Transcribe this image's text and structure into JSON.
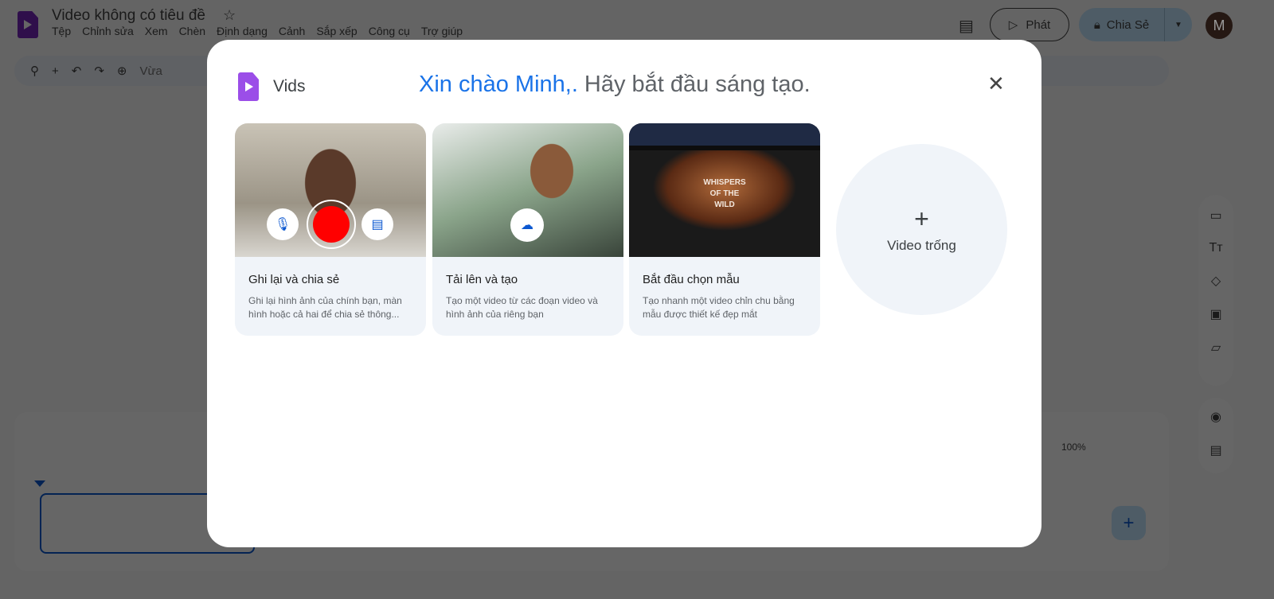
{
  "app": {
    "title": "Video không có tiêu đề",
    "menu": [
      "Tệp",
      "Chỉnh sửa",
      "Xem",
      "Chèn",
      "Định dạng",
      "Cảnh",
      "Sắp xếp",
      "Công cụ",
      "Trợ giúp"
    ],
    "toolbar_fit": "Vừa",
    "play_label": "Phát",
    "share_label": "Chia Sẻ",
    "avatar_initial": "M",
    "zoom_level": "100%"
  },
  "modal": {
    "brand": "Vids",
    "greeting": "Xin chào Minh,.",
    "greeting_rest": "Hãy bắt đầu sáng tạo.",
    "cards": [
      {
        "title": "Ghi lại và chia sẻ",
        "desc": "Ghi lại hình ảnh của chính bạn, màn hình hoặc cả hai để chia sẻ thông..."
      },
      {
        "title": "Tải lên và tạo",
        "desc": "Tạo một video từ các đoạn video và hình ảnh của riêng bạn"
      },
      {
        "title": "Bắt đầu chọn mẫu",
        "desc": "Tạo nhanh một video chỉn chu bằng mẫu được thiết kế đẹp mắt",
        "thumb_text": "WHISPERS OF THE WILD"
      }
    ],
    "blank_label": "Video trống"
  },
  "colors": {
    "accent": "#0b57d0",
    "record": "#ff0000",
    "card_bg": "#f0f4f9"
  }
}
